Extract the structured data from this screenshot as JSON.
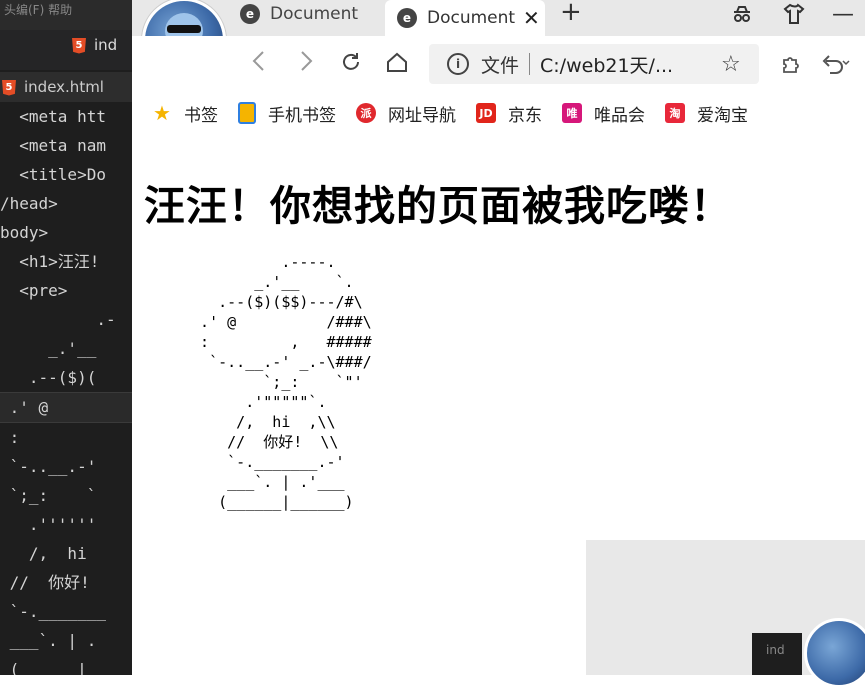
{
  "editor": {
    "top_text": "头编(F)  帮助",
    "tab_label": "ind",
    "file_tab": "index.html",
    "lines": [
      {
        "text": "  <meta htt"
      },
      {
        "text": "  <meta nam"
      },
      {
        "text": "  <title>Do"
      },
      {
        "text": "/head>"
      },
      {
        "text": "body>"
      },
      {
        "text": "  <h1>汪汪!"
      },
      {
        "text": "  <pre>"
      },
      {
        "text": "          .-"
      },
      {
        "text": "     _.'__"
      },
      {
        "text": "   .--($)("
      },
      {
        "text": " .' @"
      },
      {
        "text": " :"
      },
      {
        "text": " `-..__.-'"
      },
      {
        "text": " `;_:    `"
      },
      {
        "text": "   .''''''"
      },
      {
        "text": "   /,  hi"
      },
      {
        "text": " //  你好!"
      },
      {
        "text": " `-._______"
      },
      {
        "text": " ___`. | ."
      },
      {
        "text": " (______|_"
      }
    ]
  },
  "browser": {
    "tabs": [
      {
        "title": "Document",
        "active": false
      },
      {
        "title": "Document",
        "active": true
      }
    ],
    "new_tab": "+",
    "address": {
      "label": "文件",
      "url": "C:/web21天/..."
    },
    "bookmarks": [
      {
        "label": "书签",
        "icon": "star-icon",
        "color": "#f5b400"
      },
      {
        "label": "手机书签",
        "icon": "phone-icon",
        "color": "#2f7fe0"
      },
      {
        "label": "网址导航",
        "icon": "nav-icon",
        "color": "#e0282d"
      },
      {
        "label": "京东",
        "icon": "jd-icon",
        "color": "#e1251b"
      },
      {
        "label": "唯品会",
        "icon": "vip-icon",
        "color": "#d6177a"
      },
      {
        "label": "爱淘宝",
        "icon": "taobao-icon",
        "color": "#e8283a"
      }
    ]
  },
  "page": {
    "heading": "汪汪！你想找的页面被我吃喽！",
    "ascii": "           .----.\n        _.'__    `.\n    .--($)($$)---/#\\\n  .' @          /###\\\n  :         ,   #####\n   `-..__.-' _.-\\###/\n         `;_:    `\"'\n       .'\"\"\"\"\"`.\n      /,  hi  ,\\\\\n     //  你好!  \\\\\n     `-._______.-'\n     ___`. | .'___\n    (______|______)"
  },
  "mini": {
    "label": "ind"
  }
}
